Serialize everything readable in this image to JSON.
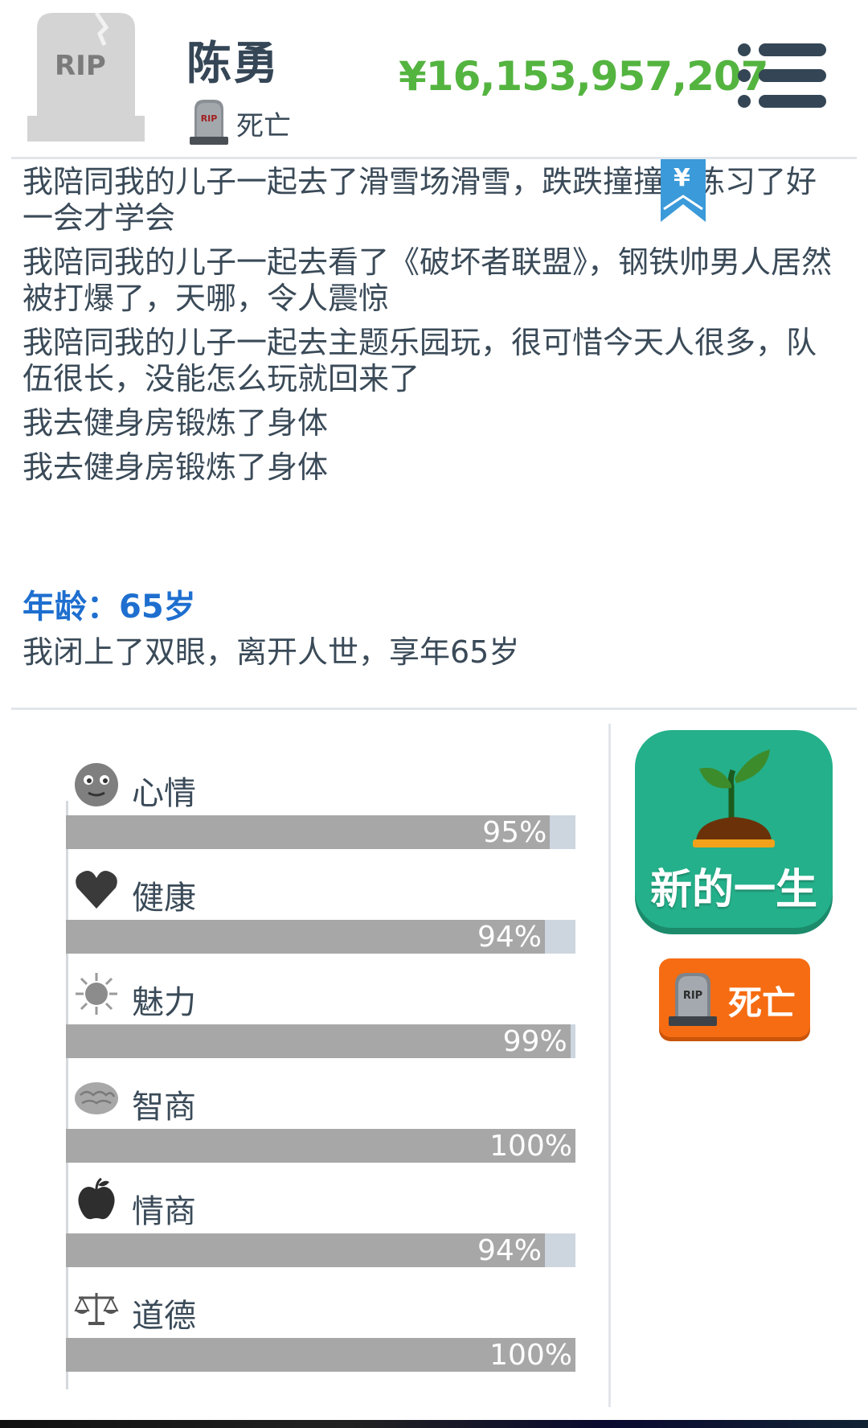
{
  "header": {
    "tombstone_text": "RIP",
    "player_name": "陈勇",
    "status_icon": "rip-gravestone-icon",
    "status_text": "死亡",
    "money": "¥16,153,957,207",
    "menu_icon": "list-menu-icon"
  },
  "bookmark": {
    "icon": "yen-bookmark-icon",
    "text": "¥"
  },
  "log": {
    "entries": [
      "我陪同我的儿子一起去了滑雪场滑雪，跌跌撞撞的练习了好一会才学会",
      "我陪同我的儿子一起去看了《破坏者联盟》，钢铁帅男人居然被打爆了，天哪，令人震惊",
      "我陪同我的儿子一起去主题乐园玩，很可惜今天人很多，队伍很长，没能怎么玩就回来了",
      "我去健身房锻炼了身体",
      "我去健身房锻炼了身体"
    ],
    "age_label": "年龄：65岁",
    "death_text": "我闭上了双眼，离开人世，享年65岁"
  },
  "stats": [
    {
      "label": "心情",
      "icon": "mood-face-icon",
      "percent": 95,
      "value_text": "95%"
    },
    {
      "label": "健康",
      "icon": "heart-icon",
      "percent": 94,
      "value_text": "94%"
    },
    {
      "label": "魅力",
      "icon": "sun-icon",
      "percent": 99,
      "value_text": "99%"
    },
    {
      "label": "智商",
      "icon": "brain-icon",
      "percent": 100,
      "value_text": "100%"
    },
    {
      "label": "情商",
      "icon": "apple-icon",
      "percent": 94,
      "value_text": "94%"
    },
    {
      "label": "道德",
      "icon": "scales-icon",
      "percent": 100,
      "value_text": "100%"
    }
  ],
  "buttons": {
    "new_life_label": "新的一生",
    "new_life_icon": "sprout-icon",
    "death_label": "死亡",
    "death_icon": "rip-gravestone-icon"
  },
  "colors": {
    "money": "#54b440",
    "age_label": "#1e6fcf",
    "new_life_bg": "#24b08a",
    "death_bg": "#f66c12",
    "bar_fill": "#a7a7a7",
    "bar_track": "#cdd6df"
  }
}
